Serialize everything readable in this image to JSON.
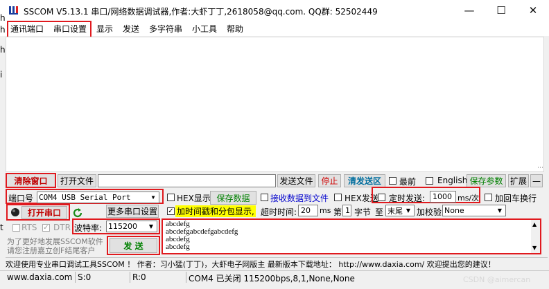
{
  "window": {
    "title": "SSCOM V5.13.1 串口/网络数据调试器,作者:大虾丁丁,2618058@qq.com. QQ群:  52502449",
    "minimize": "—",
    "maximize": "☐",
    "close": "✕"
  },
  "menu": [
    "通讯端口",
    "串口设置",
    "显示",
    "发送",
    "多字符串",
    "小工具",
    "帮助"
  ],
  "edge_chars": [
    "h",
    "h",
    "h",
    "i",
    "t"
  ],
  "toolbar1": {
    "clear_window": "清除窗口",
    "open_file": "打开文件",
    "file_path": "",
    "send_file": "发送文件",
    "stop": "停止",
    "clear_send": "清发送区",
    "topmost": "最前",
    "english": "English",
    "save_params": "保存参数",
    "expand": "扩展",
    "collapse": "—"
  },
  "port_row": {
    "port_label": "端口号",
    "port_value": "COM4 USB Serial Port",
    "hex_display": "HEX显示",
    "save_data": "保存数据",
    "recv_to_file": "接收数据到文件",
    "hex_send": "HEX发送",
    "timed_send": "定时发送:",
    "interval": "1000",
    "interval_unit": "ms/次",
    "add_crlf": "加回车换行"
  },
  "row3": {
    "open_port": "打开串口",
    "more_settings": "更多串口设置",
    "timestamp": "加时间戳和分包显示,",
    "timeout_label": "超时时间:",
    "timeout_value": "20",
    "timeout_unit": "ms",
    "nth_label": "第",
    "nth_value": "1",
    "byte_label": "字节",
    "to_label": "至",
    "to_value": "末尾",
    "checksum_label": "加校验",
    "checksum_value": "None"
  },
  "row4": {
    "rts": "RTS",
    "dtr": "DTR",
    "baud_label": "波特率:",
    "baud_value": "115200"
  },
  "ad": {
    "line1": "为了更好地发展SSCOM软件",
    "line2": "请您注册嘉立创F结尾客户"
  },
  "send_button": "发  送",
  "send_lines": [
    "abcdefg",
    "abcdefgabcdefgabcdefg",
    "abcdefg",
    "abcdefg"
  ],
  "banner": "欢迎使用专业串口调试工具SSCOM ！  作者：习小猛(丁丁)，大虾电子网版主  最新版本下载地址： http://www.daxia.com/  欢迎提出您的建议！",
  "status": {
    "website": "www.daxia.com",
    "sent": "S:0",
    "received": "R:0",
    "port_state": "COM4 已关闭  115200bps,8,1,None,None"
  },
  "watermark": "CSDN @aimercan",
  "colors": {
    "highlight_box": "#e0191e",
    "green_text": "#008000",
    "link_blue": "#0000cc",
    "timestamp_bg": "#ffff00"
  }
}
